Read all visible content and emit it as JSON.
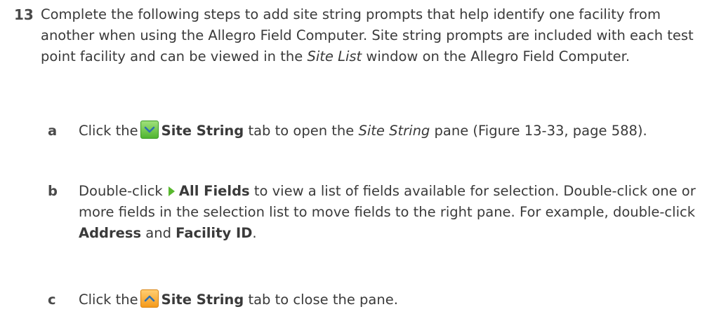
{
  "step": {
    "number": "13",
    "text_a": "Complete the following steps to add site string prompts that help identify one facility from another when using the Allegro Field Computer. Site string prompts are included with each test point facility and can be viewed in the ",
    "text_italic": "Site List",
    "text_b": " window on the Allegro Field Computer."
  },
  "substeps": [
    {
      "letter": "a",
      "t1": "Click the",
      "icon": "chevron-down-icon",
      "bold": "Site String",
      "t2": " tab to open the ",
      "italic": "Site String",
      "t3": " pane (Figure 13-33, page 588)."
    },
    {
      "letter": "b",
      "t1": "Double-click",
      "icon": "triangle-right-icon",
      "bold": "All Fields",
      "t2": " to view a list of fields available for selection. Double-click one or more fields in the selection list to move fields to the right pane. For example, double-click ",
      "bold2": "Address",
      "t3": " and ",
      "bold3": "Facility ID",
      "t4": "."
    },
    {
      "letter": "c",
      "t1": "Click the",
      "icon": "chevron-up-icon",
      "bold": "Site String",
      "t2": " tab to close the pane."
    }
  ],
  "colors": {
    "text": "#3a3a3a",
    "icon_green": "#4fb530",
    "icon_orange": "#f59a1b"
  }
}
